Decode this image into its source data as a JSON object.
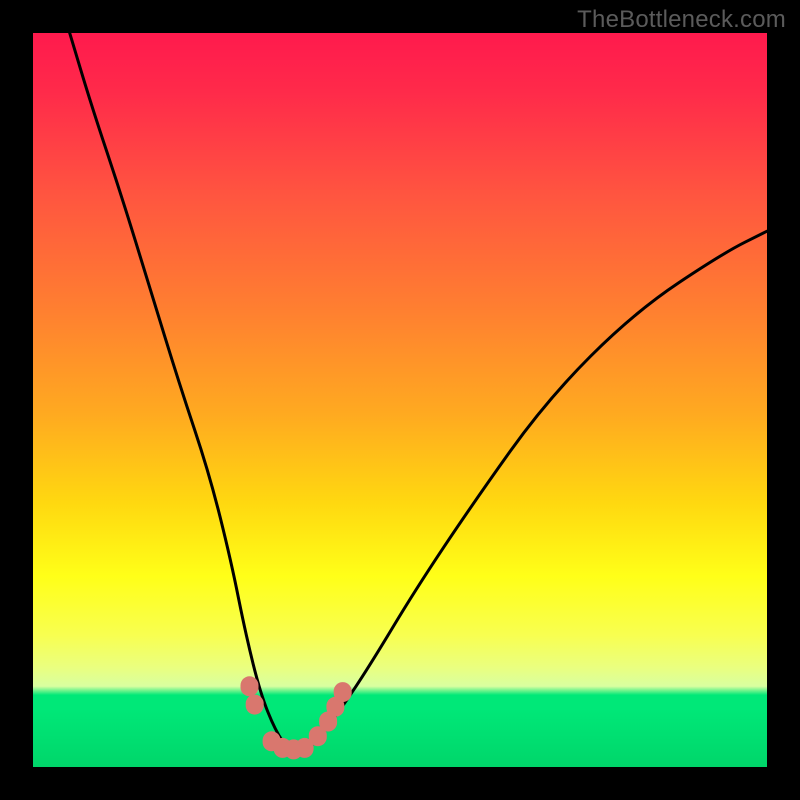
{
  "watermark": "TheBottleneck.com",
  "colors": {
    "frame": "#000000",
    "gradient_top": "#ff1a4d",
    "gradient_mid": "#ffff18",
    "gradient_green": "#00e878",
    "curve": "#000000",
    "marker": "#d9776e"
  },
  "chart_data": {
    "type": "line",
    "title": "",
    "xlabel": "",
    "ylabel": "",
    "xlim": [
      0,
      100
    ],
    "ylim": [
      0,
      100
    ],
    "series": [
      {
        "name": "bottleneck-curve",
        "x": [
          5,
          8,
          12,
          16,
          20,
          24,
          27,
          29,
          31,
          33,
          35,
          37,
          39,
          42,
          46,
          52,
          60,
          70,
          82,
          94,
          100
        ],
        "y": [
          100,
          90,
          78,
          65,
          52,
          40,
          28,
          18,
          10,
          5,
          2,
          2,
          4,
          8,
          14,
          24,
          36,
          50,
          62,
          70,
          73
        ]
      }
    ],
    "markers": [
      {
        "x": 29.5,
        "y": 11
      },
      {
        "x": 30.2,
        "y": 8.5
      },
      {
        "x": 32.5,
        "y": 3.5
      },
      {
        "x": 34,
        "y": 2.6
      },
      {
        "x": 35.5,
        "y": 2.4
      },
      {
        "x": 37,
        "y": 2.6
      },
      {
        "x": 38.8,
        "y": 4.2
      },
      {
        "x": 40.2,
        "y": 6.2
      },
      {
        "x": 41.2,
        "y": 8.2
      },
      {
        "x": 42.2,
        "y": 10.2
      }
    ],
    "annotations": []
  }
}
